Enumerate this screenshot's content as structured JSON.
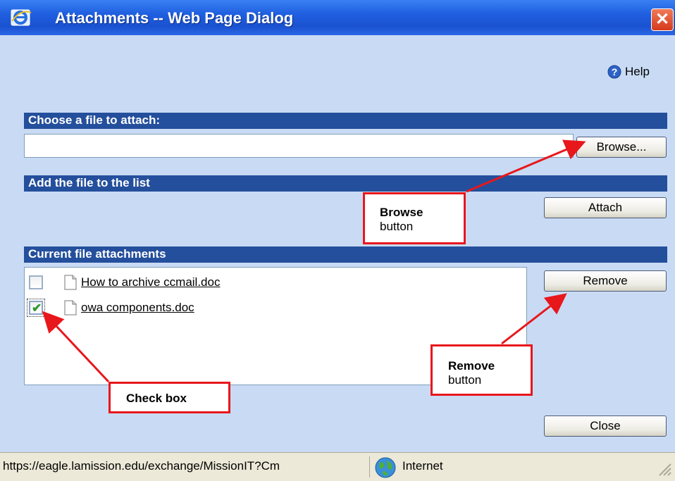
{
  "window": {
    "title": "Attachments -- Web Page Dialog",
    "close_glyph": "✕",
    "close_icon": "close-icon",
    "app_icon": "internet-explorer-icon"
  },
  "help": {
    "label": "Help",
    "icon": "help-icon"
  },
  "sections": {
    "choose": "Choose a file to attach:",
    "add": "Add the file to the list",
    "current": "Current file attachments"
  },
  "file_input": {
    "value": "",
    "placeholder": ""
  },
  "buttons": {
    "browse": "Browse...",
    "attach": "Attach",
    "remove": "Remove",
    "close": "Close"
  },
  "attachments": [
    {
      "name": "How to archive ccmail.doc",
      "checked": false,
      "icon": "document-icon"
    },
    {
      "name": "owa components.doc",
      "checked": true,
      "icon": "document-icon"
    }
  ],
  "annotations": {
    "browse": {
      "title": "Browse",
      "sub": "button"
    },
    "remove": {
      "title": "Remove",
      "sub": "button"
    },
    "checkbox": {
      "title": "Check box"
    }
  },
  "status": {
    "url": "https://eagle.lamission.edu/exchange/MissionIT?Cm",
    "zone": "Internet",
    "zone_icon": "globe-icon"
  },
  "colors": {
    "titlebar": "#1f5fe0",
    "dialog_bg": "#c9dbf4",
    "section_bar": "#244f9c",
    "annotation_red": "#e8171c"
  }
}
